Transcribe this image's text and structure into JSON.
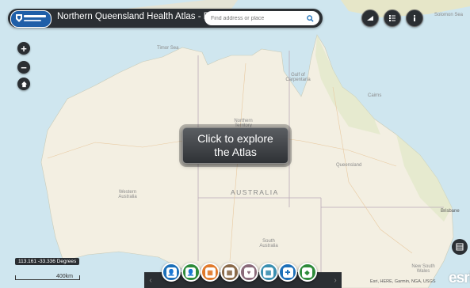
{
  "header": {
    "title": "Northern Queensland Health Atlas - Pilot",
    "search_placeholder": "Find address or place"
  },
  "map": {
    "explore_label": "Click to explore the Atlas",
    "coordinates": "113.161 -33.336 Degrees",
    "scale_label": "400km",
    "attribution": "Esri, HERE, Garmin, NGA, USGS",
    "esri_logo": "esri",
    "labels": {
      "timor_sea": "Timor Sea",
      "gulf": "Gulf of Carpentaria",
      "solomon_sea": "Solomon Sea",
      "cairns": "Cairns",
      "queensland": "Queensland",
      "western_australia": "Western Australia",
      "australia": "AUSTRALIA",
      "south_australia": "South Australia",
      "brisbane": "Brisbane",
      "nsw": "New South Wales",
      "northern_territory": "Northern Territory"
    }
  },
  "toolbar": {
    "buttons": [
      {
        "name": "population-tool",
        "icon": "person-icon",
        "color": "#1c6fb8",
        "glyph": "👤"
      },
      {
        "name": "community-tool",
        "icon": "person-icon",
        "color": "#2e8b3a",
        "glyph": "👤"
      },
      {
        "name": "services-tool",
        "icon": "building-icon",
        "color": "#e07a2c",
        "glyph": "▦"
      },
      {
        "name": "facilities-tool",
        "icon": "hospital-icon",
        "color": "#8a6a4a",
        "glyph": "▦"
      },
      {
        "name": "health-tool",
        "icon": "heart-icon",
        "color": "#8a6a7a",
        "glyph": "♥"
      },
      {
        "name": "workforce-tool",
        "icon": "building-icon",
        "color": "#3a8fb0",
        "glyph": "▦"
      },
      {
        "name": "medical-tool",
        "icon": "cross-icon",
        "color": "#1c6fb8",
        "glyph": "✚"
      },
      {
        "name": "region-tool",
        "icon": "australia-icon",
        "color": "#2e8b3a",
        "glyph": "◆"
      }
    ]
  },
  "colors": {
    "panel": "#2b2f33",
    "land": "#f3efe2",
    "water": "#cfe6ef"
  }
}
